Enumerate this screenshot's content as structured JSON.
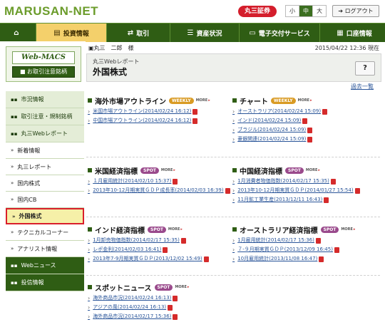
{
  "header": {
    "logo": "MARUSAN-NET",
    "brand": "丸三証券",
    "font_sizes": [
      "小",
      "中",
      "大"
    ],
    "active_size": "中",
    "logout": "ログアウト"
  },
  "nav": [
    {
      "label": "",
      "icon": "home-icon",
      "glyph": "⌂"
    },
    {
      "label": "投資情報",
      "icon": "chart-icon",
      "glyph": "▤",
      "active": true
    },
    {
      "label": "取引",
      "icon": "trade-icon",
      "glyph": "⇄"
    },
    {
      "label": "資産状況",
      "icon": "database-icon",
      "glyph": "☰"
    },
    {
      "label": "電子交付サービス",
      "icon": "monitor-icon",
      "glyph": "▭"
    },
    {
      "label": "口座情報",
      "icon": "card-icon",
      "glyph": "▦"
    }
  ],
  "sidebar": {
    "webmacs_label": "Web-MACS",
    "order_button": "■ お取引注意銘柄",
    "items": [
      {
        "label": "市況情報",
        "style": "main"
      },
      {
        "label": "取引注意・規制銘柄",
        "style": "main"
      },
      {
        "label": "丸三Webレポート",
        "style": "main"
      },
      {
        "label": "新着情報",
        "style": "sub"
      },
      {
        "label": "丸三レポート",
        "style": "sub"
      },
      {
        "label": "国内株式",
        "style": "sub"
      },
      {
        "label": "国内CB",
        "style": "sub"
      },
      {
        "label": "外国株式",
        "style": "selected"
      },
      {
        "label": "テクニカルコーナー",
        "style": "sub"
      },
      {
        "label": "アナリスト情報",
        "style": "sub"
      },
      {
        "label": "Webニュース",
        "style": "main-dark"
      },
      {
        "label": "投信情報",
        "style": "main-dark"
      }
    ]
  },
  "user": {
    "name": "丸三　二郎　様",
    "timestamp": "2015/04/22 12:36 現在"
  },
  "page": {
    "report_label": "丸三Webレポート",
    "title": "外国株式",
    "help": "?",
    "past_link": "過去一覧"
  },
  "sections": [
    {
      "title": "海外市場アウトライン",
      "tag": "WEEKLY",
      "tag_type": "weekly",
      "items": [
        "米国市場アウトライン(2014/02/24 16:12)",
        "中国市場アウトライン(2014/02/24 16:12)"
      ]
    },
    {
      "title": "チャート",
      "tag": "WEEKLY",
      "tag_type": "weekly",
      "items": [
        "オーストラリア(2014/02/24 15:09)",
        "インド(2014/02/24 15:09)",
        "ブラジル(2014/02/24 15:09)",
        "豪銀関連(2014/02/24 15:09)"
      ]
    },
    {
      "title": "米国経済指標",
      "tag": "SPOT",
      "tag_type": "spot",
      "items": [
        "１月雇用統計(2014/02/10 15:37)",
        "2013年10-12月期実質ＧＤＰ成長率(2014/02/03 16:39)"
      ]
    },
    {
      "title": "中国経済指標",
      "tag": "SPOT",
      "tag_type": "spot",
      "items": [
        "1月消費者物価指数(2014/02/17 15:35)",
        "2013年10-12月期実質ＧＤＰ(2014/01/27 15:54)",
        "11月鉱工業生産(2013/12/11 16:43)"
      ]
    },
    {
      "title": "インド経済指標",
      "tag": "SPOT",
      "tag_type": "spot",
      "items": [
        "1月卸売物価指数(2014/02/17 15:35)",
        "レポ金利(2014/02/03 16:41)",
        "2013年7-9月期実質ＧＤＰ(2013/12/02 15:49)"
      ]
    },
    {
      "title": "オーストラリア経済指標",
      "tag": "SPOT",
      "tag_type": "spot",
      "items": [
        "1月雇用統計(2014/02/17 15:36)",
        "７-９月期実質ＧＤＰ(2013/12/09 16:45)",
        "10月雇用統計(2013/11/08 16:47)"
      ]
    },
    {
      "title": "スポットニュース",
      "tag": "SPOT",
      "tag_type": "spot",
      "items": [
        "海外商品市況(2014/02/24 16:13)",
        "アジアの風(2014/02/24 16:13)",
        "海外商品市況(2014/02/17 15:36)"
      ]
    }
  ]
}
